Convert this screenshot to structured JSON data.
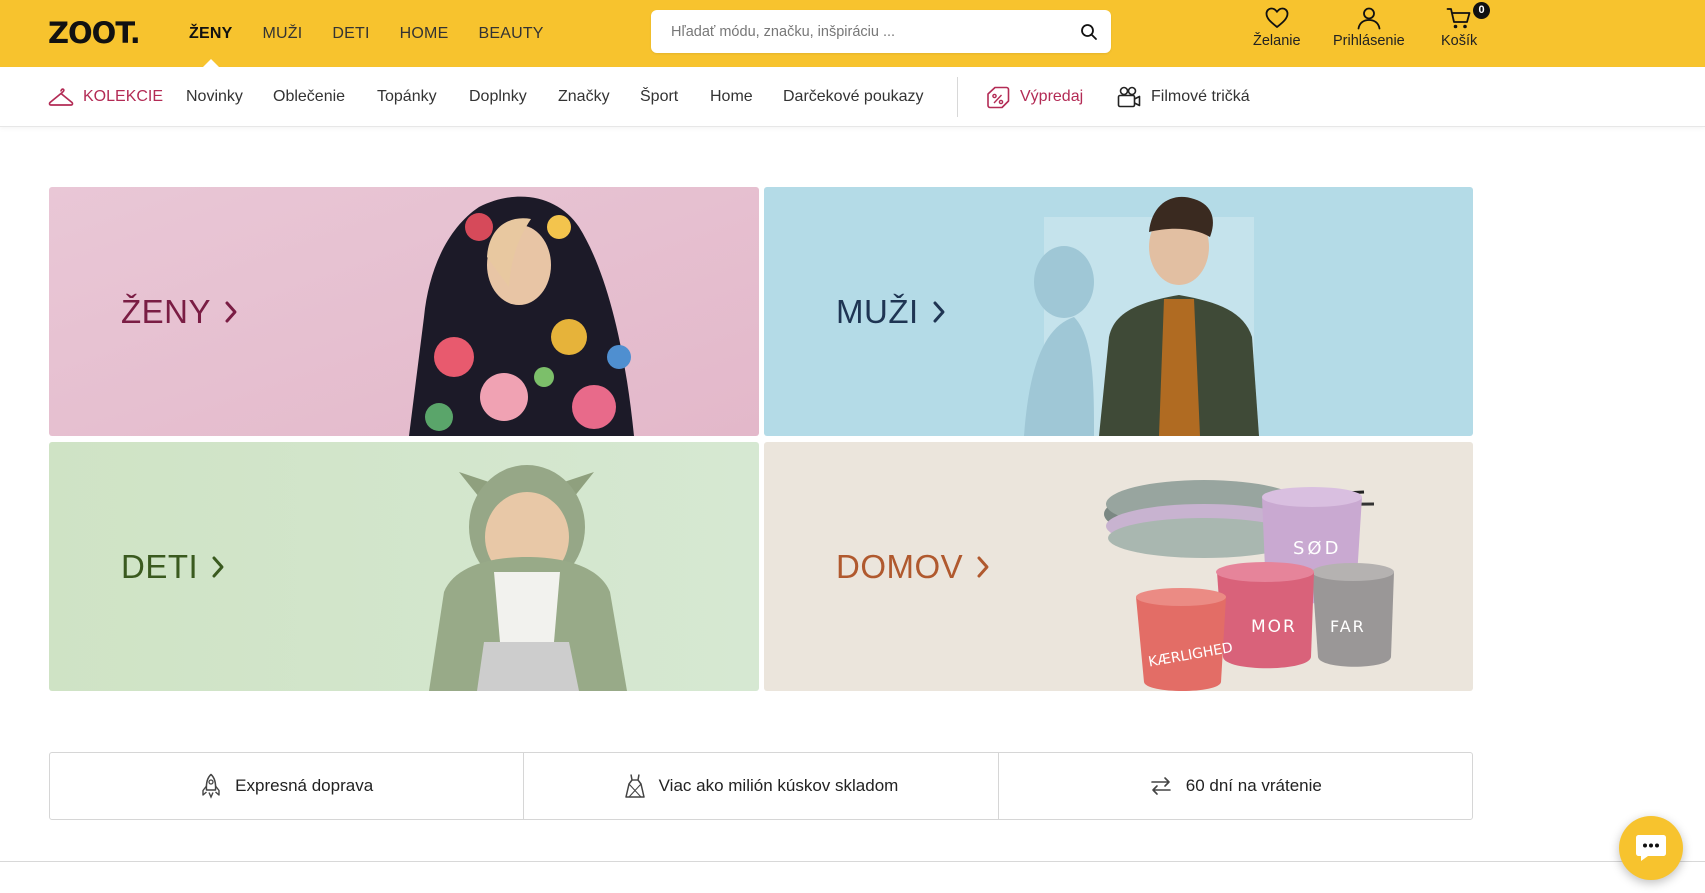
{
  "logo": "ZOOT.",
  "gender_nav": [
    {
      "label": "ŽENY",
      "active": true
    },
    {
      "label": "MUŽI",
      "active": false
    },
    {
      "label": "DETI",
      "active": false
    },
    {
      "label": "HOME",
      "active": false
    },
    {
      "label": "BEAUTY",
      "active": false
    }
  ],
  "search": {
    "placeholder": "Hľadať módu, značku, inšpiráciu ...",
    "value": ""
  },
  "user_actions": {
    "wishlist": "Želanie",
    "login": "Prihlásenie",
    "cart": "Košík",
    "cart_count": "0"
  },
  "subnav": {
    "collections": "KOLEKCIE",
    "items": [
      "Novinky",
      "Oblečenie",
      "Topánky",
      "Doplnky",
      "Značky",
      "Šport",
      "Home",
      "Darčekové poukazy"
    ],
    "sale": "Výpredaj",
    "movie_tshirts": "Filmové tričká"
  },
  "tiles": [
    {
      "label": "ŽENY",
      "color": "#7a1d44",
      "bg": "#e6c3d2"
    },
    {
      "label": "MUŽI",
      "color": "#1f3553",
      "bg": "#b4dbe7"
    },
    {
      "label": "DETI",
      "color": "#3a5a1f",
      "bg": "#cfe3c7"
    },
    {
      "label": "DOMOV",
      "color": "#b0592e",
      "bg": "#ebe5dc"
    }
  ],
  "mug_texts": [
    "SØD",
    "MOR",
    "FAR",
    "KÆRLIGHED"
  ],
  "benefits": [
    "Expresná doprava",
    "Viac ako milión kúskov skladom",
    "60 dní na vrátenie"
  ],
  "colors": {
    "brand_yellow": "#f7c32e",
    "accent_pink": "#b32b55"
  }
}
